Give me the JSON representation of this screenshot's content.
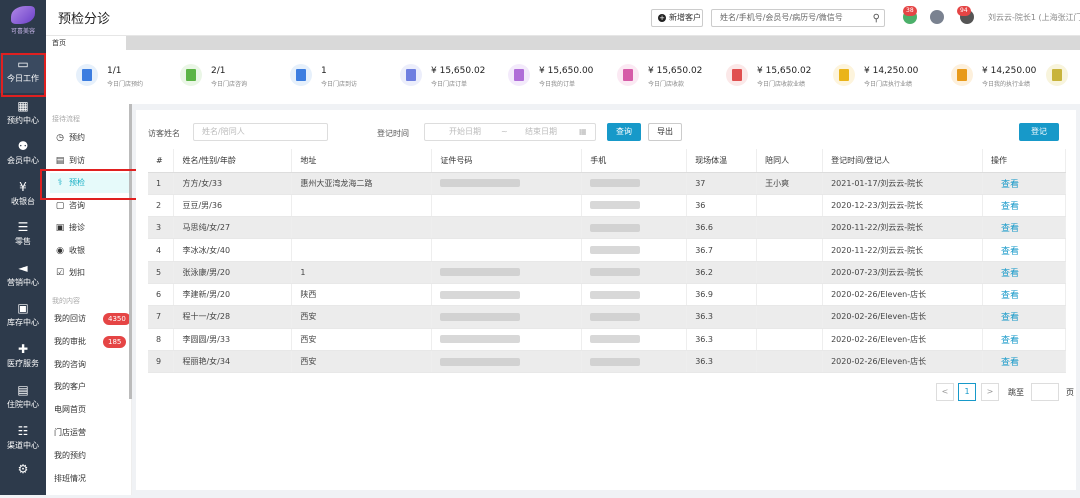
{
  "brand": {
    "name": "可喜美容"
  },
  "nav": [
    {
      "label": "今日工作",
      "icon": "laptop-icon",
      "active": true
    },
    {
      "label": "预约中心",
      "icon": "calendar-icon"
    },
    {
      "label": "会员中心",
      "icon": "users-icon"
    },
    {
      "label": "收银台",
      "icon": "yen-icon"
    },
    {
      "label": "零售",
      "icon": "cart-icon"
    },
    {
      "label": "营销中心",
      "icon": "megaphone-icon"
    },
    {
      "label": "库存中心",
      "icon": "grid-icon"
    },
    {
      "label": "医疗服务",
      "icon": "medkit-icon"
    },
    {
      "label": "住院中心",
      "icon": "clipboard-icon"
    },
    {
      "label": "渠道中心",
      "icon": "sitemap-icon"
    },
    {
      "label": "",
      "icon": "gear-icon"
    }
  ],
  "header": {
    "title": "预检分诊",
    "new_customer": "新增客户",
    "search_placeholder": "姓名/手机号/会员号/病历号/微信号",
    "badge1": "38",
    "badge2": "94",
    "user": "刘云云-院长1 (上海张江门店)"
  },
  "tabs": [
    {
      "label": "首页"
    }
  ],
  "stats": [
    {
      "value": "1/1",
      "label": "今日门店预约",
      "color": "#3c7de0",
      "bg": "#e6f0fb"
    },
    {
      "value": "2/1",
      "label": "今日门店咨询",
      "color": "#5bb445",
      "bg": "#eaf6e6"
    },
    {
      "value": "1",
      "label": "今日门店到访",
      "color": "#3c7de0",
      "bg": "#e6f0fb"
    },
    {
      "value": "¥ 15,650.02",
      "label": "今日门店订单",
      "color": "#6f7fe0",
      "bg": "#eceefb"
    },
    {
      "value": "¥ 15,650.00",
      "label": "今日我的订单",
      "color": "#b06ed8",
      "bg": "#f3eafb"
    },
    {
      "value": "¥ 15,650.02",
      "label": "今日门店收款",
      "color": "#d65ca8",
      "bg": "#fbe9f3"
    },
    {
      "value": "¥ 15,650.02",
      "label": "今日门店收款业绩",
      "color": "#e05050",
      "bg": "#fbe8e8"
    },
    {
      "value": "¥ 14,250.00",
      "label": "今日门店执行业绩",
      "color": "#eab41a",
      "bg": "#fdf4dc"
    },
    {
      "value": "¥ 14,250.00",
      "label": "今日我的执行业绩",
      "color": "#e89a1a",
      "bg": "#fdf0dc"
    },
    {
      "value": "",
      "label": "",
      "color": "#c8b43c",
      "bg": "#f8f4dc"
    }
  ],
  "subnav": {
    "section1": "接待流程",
    "items1": [
      {
        "label": "预约",
        "icon": "clock-icon"
      },
      {
        "label": "到访",
        "icon": "id-card-icon"
      },
      {
        "label": "预检",
        "icon": "stethoscope-icon",
        "active": true
      },
      {
        "label": "咨询",
        "icon": "chat-icon"
      },
      {
        "label": "接诊",
        "icon": "briefcase-icon"
      },
      {
        "label": "收银",
        "icon": "coin-icon"
      },
      {
        "label": "划扣",
        "icon": "check-square-icon"
      }
    ],
    "section2": "我的内容",
    "items2": [
      {
        "label": "我的回访",
        "count": "4350"
      },
      {
        "label": "我的审批",
        "count": "185"
      },
      {
        "label": "我的咨询",
        "count": ""
      },
      {
        "label": "我的客户",
        "count": ""
      },
      {
        "label": "电网首页",
        "count": ""
      },
      {
        "label": "门店运营",
        "count": ""
      },
      {
        "label": "我的预约",
        "count": ""
      },
      {
        "label": "排班情况",
        "count": ""
      }
    ]
  },
  "filters": {
    "visitor_label": "访客姓名",
    "visitor_placeholder": "姓名/陪同人",
    "time_label": "登记时间",
    "start_placeholder": "开始日期",
    "range_sep": "~",
    "end_placeholder": "结束日期",
    "query": "查询",
    "export": "导出",
    "register": "登记"
  },
  "table": {
    "headers": [
      "#",
      "姓名/性别/年龄",
      "地址",
      "证件号码",
      "手机",
      "现场体温",
      "陪同人",
      "登记时间/登记人",
      "操作"
    ],
    "rows": [
      {
        "no": "1",
        "name": "方方/女/33",
        "addr": "惠州大亚湾龙海二路",
        "temp": "37",
        "comp": "王小爽",
        "time": "2021-01-17/刘云云-院长",
        "action": "查看",
        "blurId": true
      },
      {
        "no": "2",
        "name": "豆豆/男/36",
        "addr": "",
        "temp": "36",
        "comp": "",
        "time": "2020-12-23/刘云云-院长",
        "action": "查看",
        "blurId": false
      },
      {
        "no": "3",
        "name": "马思纯/女/27",
        "addr": "",
        "temp": "36.6",
        "comp": "",
        "time": "2020-11-22/刘云云-院长",
        "action": "查看",
        "blurId": false
      },
      {
        "no": "4",
        "name": "李冰冰/女/40",
        "addr": "",
        "temp": "36.7",
        "comp": "",
        "time": "2020-11-22/刘云云-院长",
        "action": "查看",
        "blurId": false
      },
      {
        "no": "5",
        "name": "张泳康/男/20",
        "addr": "1",
        "temp": "36.2",
        "comp": "",
        "time": "2020-07-23/刘云云-院长",
        "action": "查看",
        "blurId": true
      },
      {
        "no": "6",
        "name": "李建新/男/20",
        "addr": "陕西",
        "temp": "36.9",
        "comp": "",
        "time": "2020-02-26/Eleven-店长",
        "action": "查看",
        "blurId": true
      },
      {
        "no": "7",
        "name": "程十一/女/28",
        "addr": "西安",
        "temp": "36.3",
        "comp": "",
        "time": "2020-02-26/Eleven-店长",
        "action": "查看",
        "blurId": true
      },
      {
        "no": "8",
        "name": "李圆圆/男/33",
        "addr": "西安",
        "temp": "36.3",
        "comp": "",
        "time": "2020-02-26/Eleven-店长",
        "action": "查看",
        "blurId": true
      },
      {
        "no": "9",
        "name": "程丽艳/女/34",
        "addr": "西安",
        "temp": "36.3",
        "comp": "",
        "time": "2020-02-26/Eleven-店长",
        "action": "查看",
        "blurId": true
      }
    ]
  },
  "pager": {
    "prev": "<",
    "page": "1",
    "next": ">",
    "goto": "跳至",
    "unit": "页"
  }
}
